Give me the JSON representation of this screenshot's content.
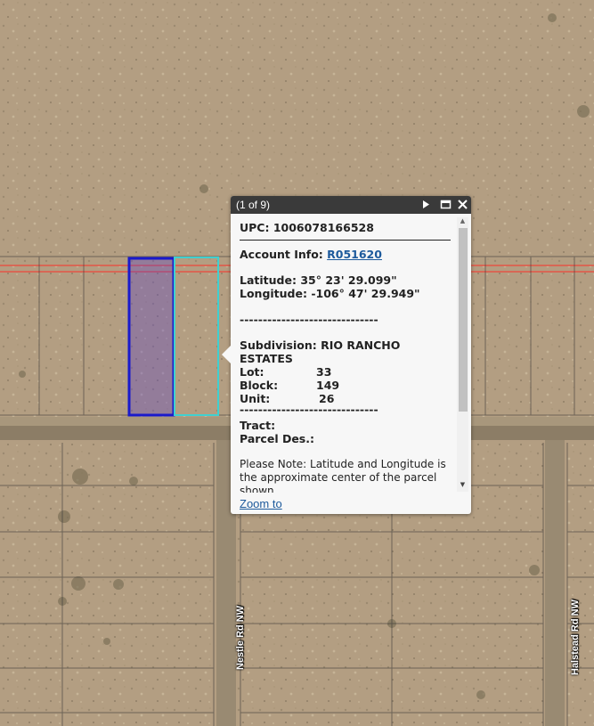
{
  "popup": {
    "title": "(1 of 9)",
    "upc_label": "UPC:",
    "upc_value": "1006078166528",
    "account_label": "Account Info:",
    "account_value": "R051620",
    "latitude_label": "Latitude:",
    "latitude_value": "35° 23' 29.099\"",
    "longitude_label": "Longitude:",
    "longitude_value": "-106° 47' 29.949\"",
    "divider": "------------------------------",
    "subdivision_label": "Subdivision:",
    "subdivision_value": "RIO RANCHO ESTATES",
    "lot_label": "Lot:",
    "lot_value": "33",
    "block_label": "Block:",
    "block_value": "149",
    "unit_label": "Unit:",
    "unit_value": "26",
    "tract_label": "Tract:",
    "tract_value": "",
    "parcel_label": "Parcel Des.:",
    "parcel_value": "",
    "note": "Please Note: Latitude and Longitude is the approximate center of the parcel shown.",
    "zoom_to": "Zoom to",
    "icons": {
      "next": "play-icon",
      "maximize": "maximize-icon",
      "close": "close-icon"
    }
  },
  "streets": [
    "Nestle Rd NW",
    "Halstead Rd NW"
  ],
  "colors": {
    "selected_parcel": "#1a1acc",
    "highlight_parcel": "#3fd0d0",
    "road_line": "#e05a4a",
    "header": "#3a3a3a"
  }
}
